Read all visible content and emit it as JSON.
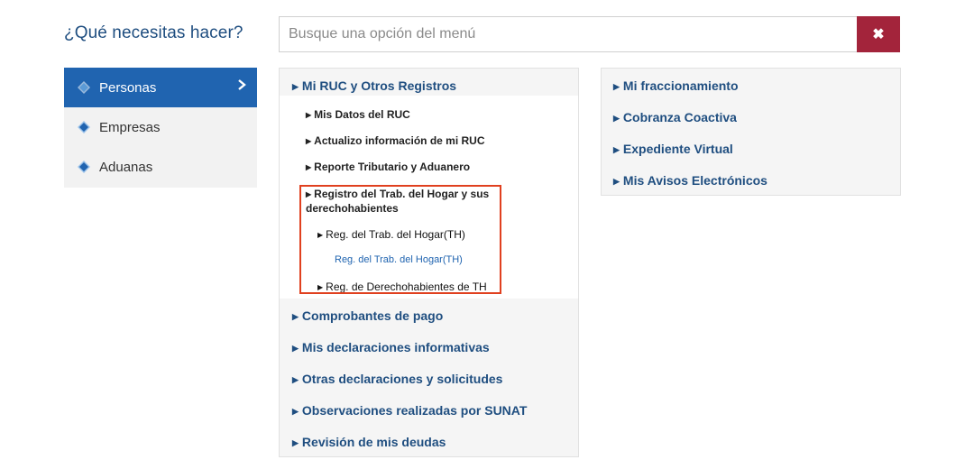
{
  "header": {
    "question": "¿Qué necesitas hacer?",
    "search_placeholder": "Busque una opción del menú",
    "clear_label": "✖"
  },
  "sidebar": {
    "items": [
      {
        "label": "Personas",
        "active": true
      },
      {
        "label": "Empresas",
        "active": false
      },
      {
        "label": "Aduanas",
        "active": false
      }
    ]
  },
  "menu": {
    "col1": {
      "mi_ruc": "Mi RUC y Otros Registros",
      "sub": {
        "mis_datos": "Mis Datos del RUC",
        "actualizo": "Actualizo información de mi RUC",
        "reporte": "Reporte Tributario y Aduanero",
        "registro_line1": "Registro del Trab. del Hogar y sus",
        "registro_line2": "derechohabientes",
        "reg_th": "Reg. del Trab. del Hogar(TH)",
        "reg_th_link": "Reg. del Trab. del Hogar(TH)",
        "reg_derecho": "Reg. de Derechohabientes de TH"
      },
      "comprobantes": "Comprobantes de pago",
      "declaraciones": "Mis declaraciones informativas",
      "otras": "Otras declaraciones y solicitudes",
      "observaciones": "Observaciones realizadas por SUNAT",
      "revision": "Revisión de mis deudas"
    },
    "col2": {
      "fraccionamiento": "Mi fraccionamiento",
      "cobranza": "Cobranza Coactiva",
      "expediente": "Expediente Virtual",
      "avisos": "Mis Avisos Electrónicos"
    }
  },
  "colors": {
    "primary_blue": "#2064b0",
    "text_blue": "#1f4e80",
    "clear_red": "#a3243b",
    "highlight_border": "#e0401f",
    "panel_bg": "#f5f5f5"
  }
}
